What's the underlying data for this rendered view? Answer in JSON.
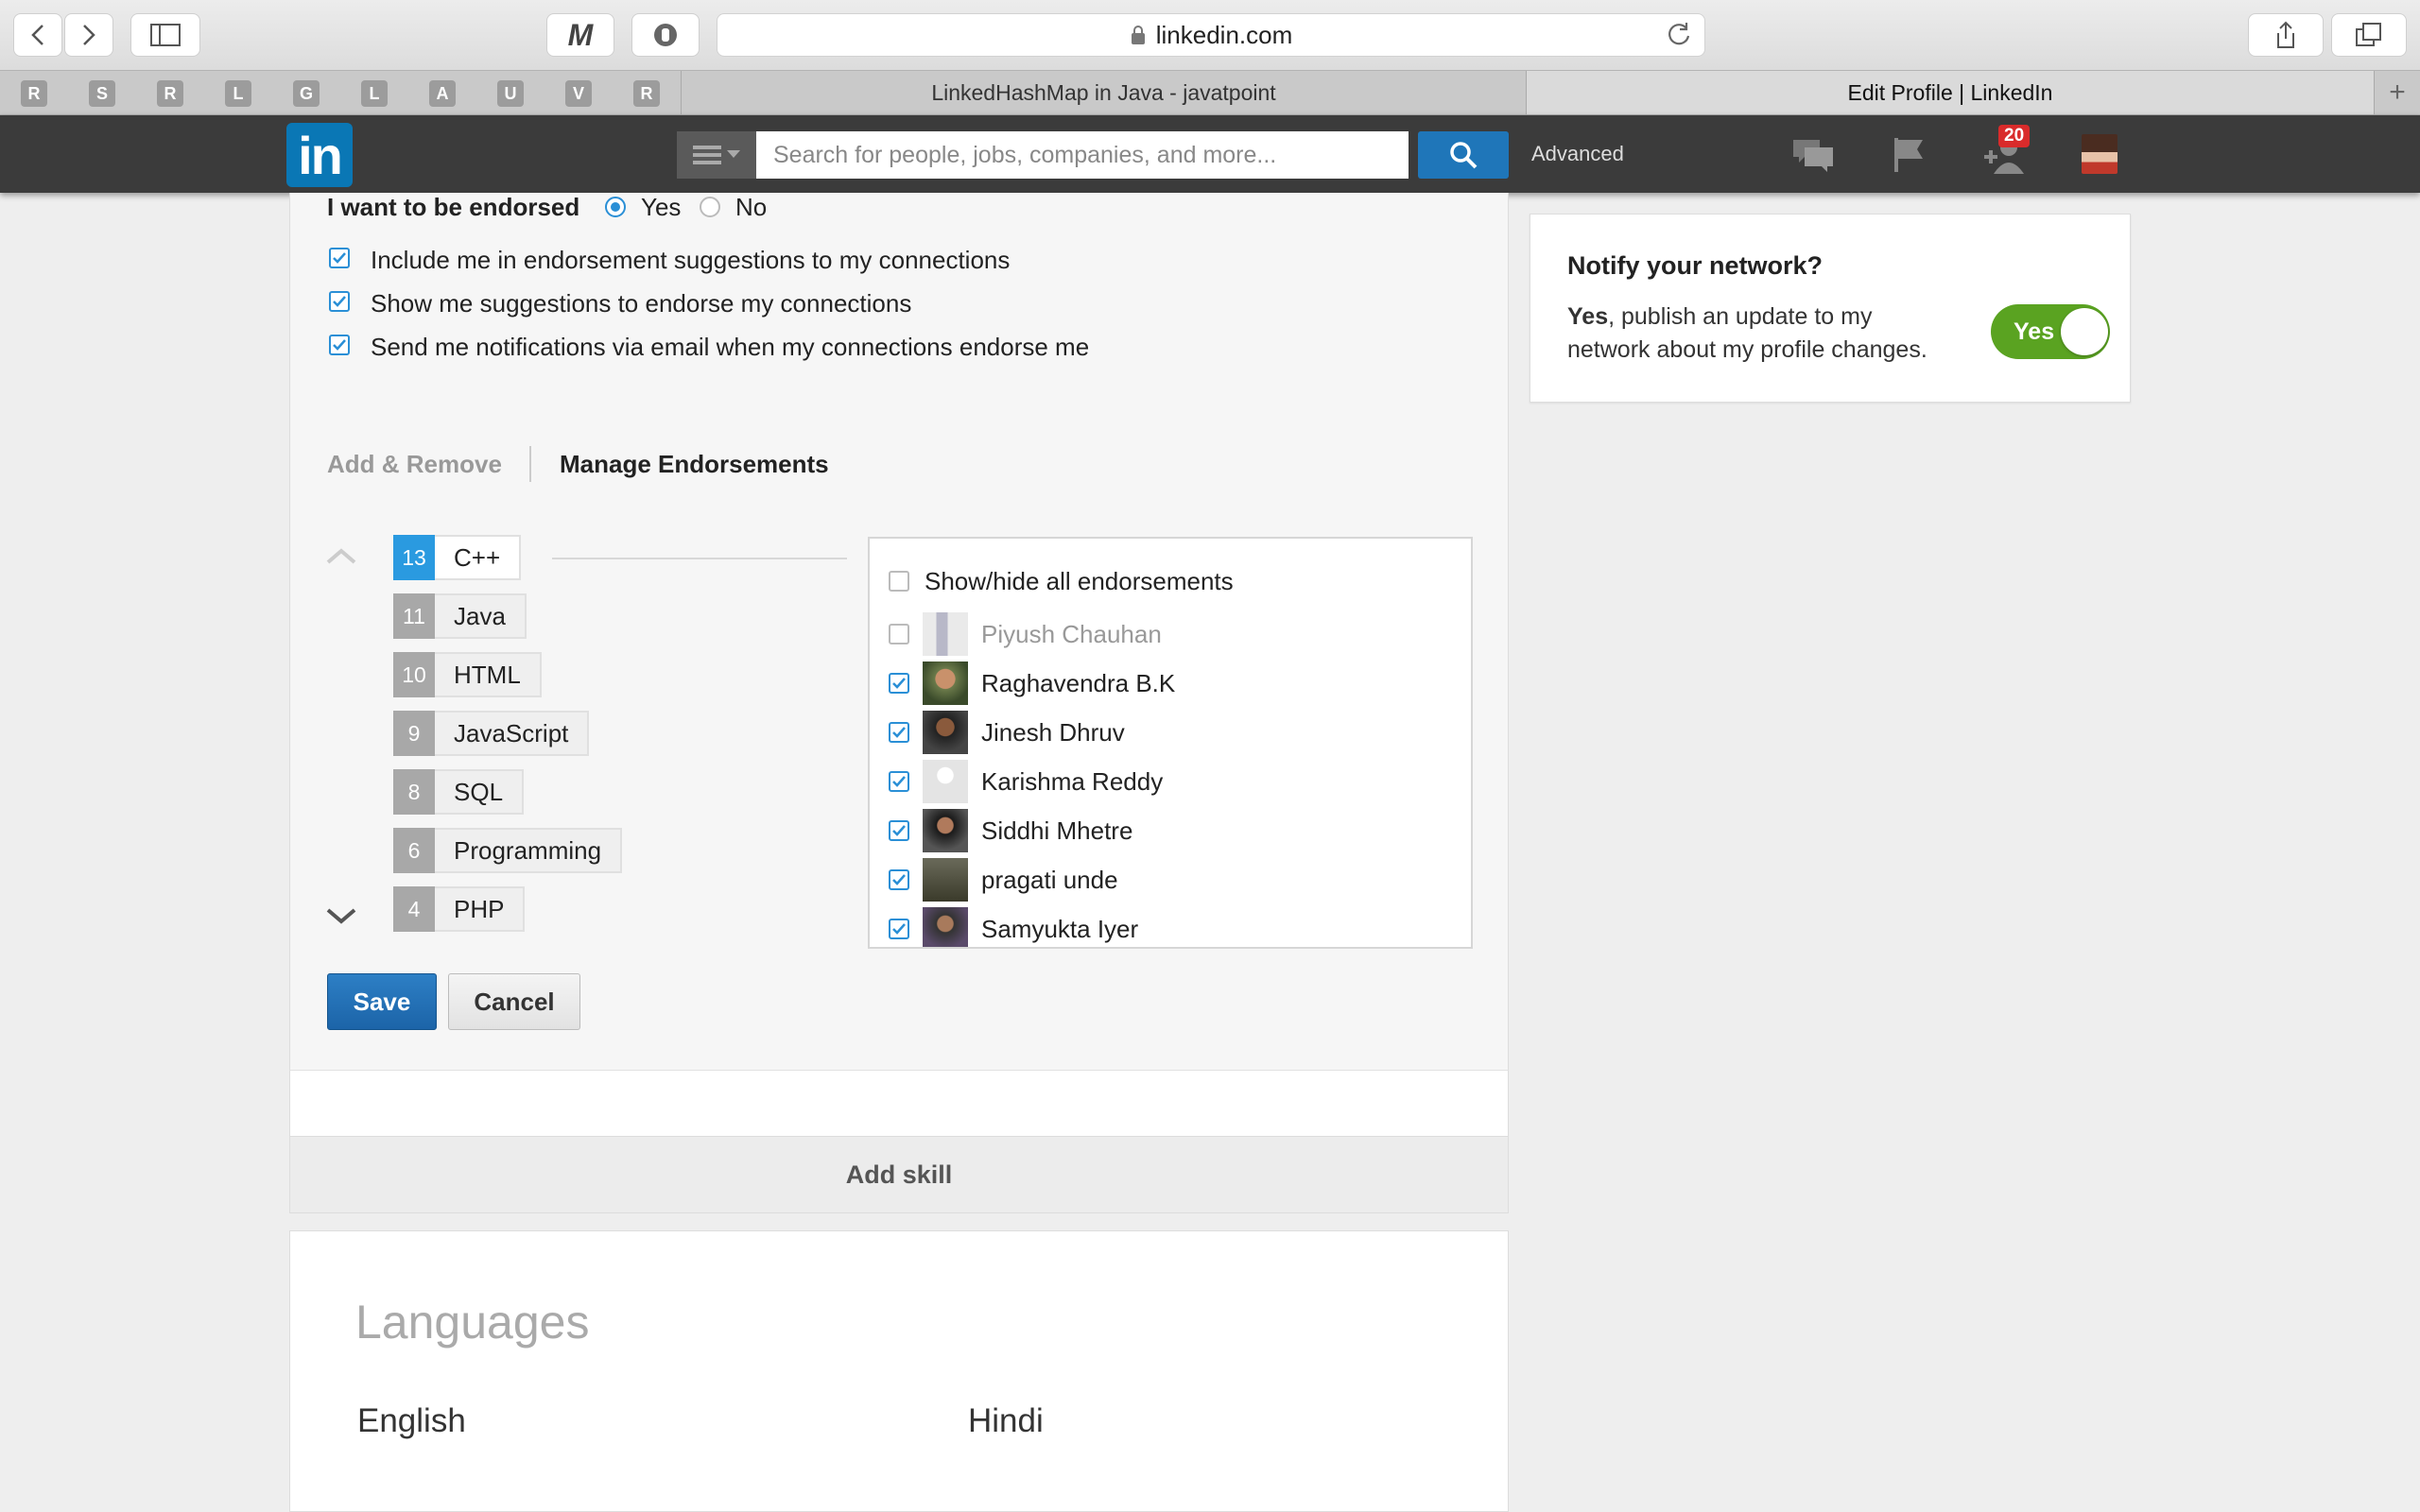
{
  "browser": {
    "url": "linkedin.com",
    "tabs": [
      {
        "label": "LinkedHashMap in Java - javatpoint",
        "active": false
      },
      {
        "label": "Edit Profile | LinkedIn",
        "active": true
      }
    ],
    "pinned": [
      "R",
      "S",
      "R",
      "L",
      "G",
      "L",
      "A",
      "U",
      "V",
      "R"
    ],
    "ext_m": "M"
  },
  "header": {
    "logo": "in",
    "search_placeholder": "Search for people, jobs, companies, and more...",
    "advanced": "Advanced",
    "notification_count": "20"
  },
  "endorse": {
    "question": "I want to be endorsed",
    "yes": "Yes",
    "no": "No",
    "options": [
      "Include me in endorsement suggestions to my connections",
      "Show me suggestions to endorse my connections",
      "Send me notifications via email when my connections endorse me"
    ]
  },
  "tabs": {
    "add_remove": "Add & Remove",
    "manage": "Manage Endorsements"
  },
  "skills": [
    {
      "count": "13",
      "name": "C++"
    },
    {
      "count": "11",
      "name": "Java"
    },
    {
      "count": "10",
      "name": "HTML"
    },
    {
      "count": "9",
      "name": "JavaScript"
    },
    {
      "count": "8",
      "name": "SQL"
    },
    {
      "count": "6",
      "name": "Programming"
    },
    {
      "count": "4",
      "name": "PHP"
    }
  ],
  "endorsements": {
    "toggle_all": "Show/hide all endorsements",
    "people": [
      {
        "name": "Piyush Chauhan",
        "checked": false
      },
      {
        "name": "Raghavendra B.K",
        "checked": true
      },
      {
        "name": "Jinesh Dhruv",
        "checked": true
      },
      {
        "name": "Karishma Reddy",
        "checked": true
      },
      {
        "name": "Siddhi Mhetre",
        "checked": true
      },
      {
        "name": "pragati unde",
        "checked": true
      },
      {
        "name": "Samyukta Iyer",
        "checked": true
      }
    ]
  },
  "buttons": {
    "save": "Save",
    "cancel": "Cancel",
    "add_skill": "Add skill"
  },
  "languages": {
    "title": "Languages",
    "items": [
      "English",
      "Hindi"
    ]
  },
  "notify": {
    "title": "Notify your network?",
    "yes_bold": "Yes",
    "text_line1": ", publish an update to my",
    "text_line2": "network about my profile changes.",
    "toggle_label": "Yes"
  },
  "colors": {
    "linkedin_blue": "#0a77b5",
    "accent": "#2a9ae0",
    "toggle_green": "#5aa321",
    "badge_red": "#d92b2b"
  }
}
